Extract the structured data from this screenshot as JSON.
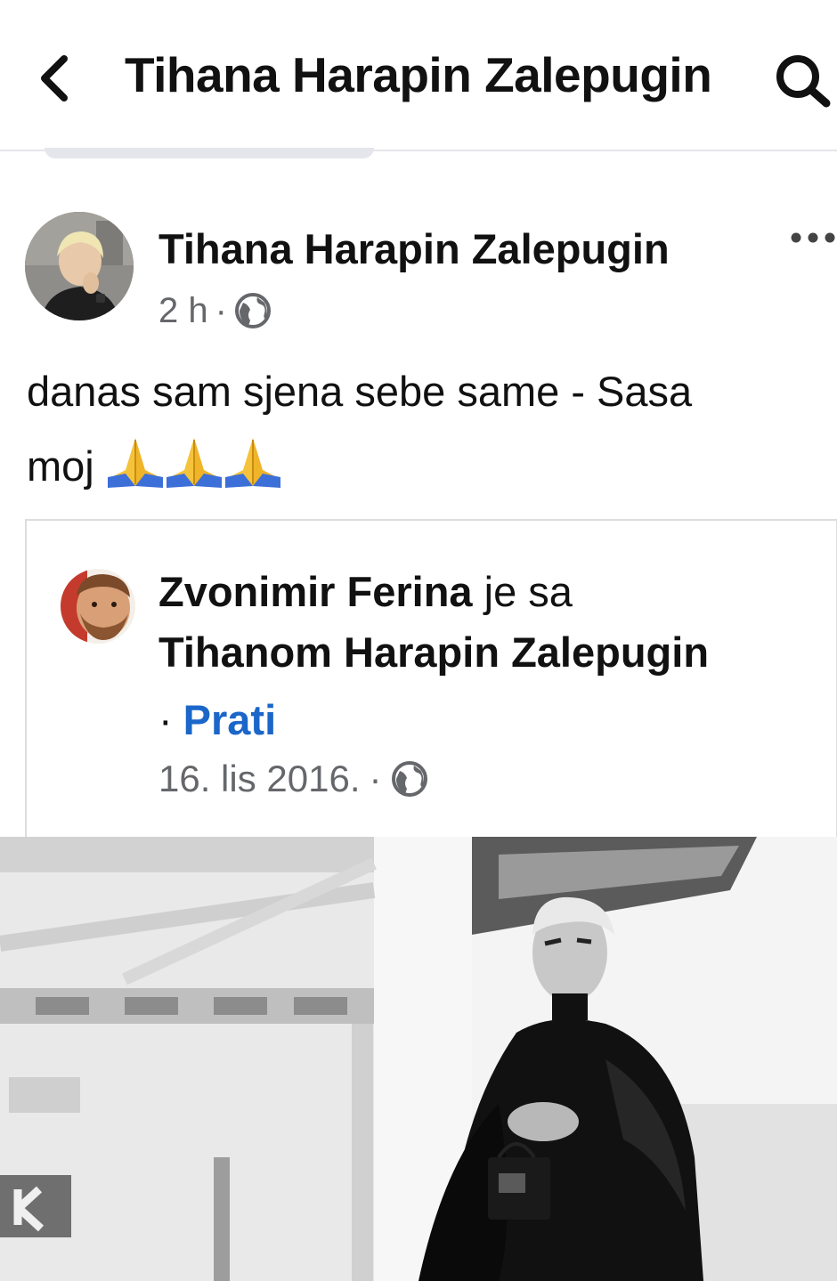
{
  "header": {
    "title": "Tihana Harapin Zalepugin",
    "back_icon": "chevron-left-icon",
    "search_icon": "search-icon"
  },
  "post": {
    "author": "Tihana Harapin Zalepugin",
    "time": "2 h",
    "separator": "·",
    "privacy_icon": "globe-icon",
    "more_icon": "more-horizontal-icon",
    "text_line1": "danas sam sjena sebe same - Sasa",
    "text_line2": "moj",
    "emoji_icon": "folded-hands-icon",
    "emoji_count": 3
  },
  "shared": {
    "author": "Zvonimir Ferina",
    "with_text": "je sa",
    "tagged": "Tihanom Harapin Zalepugin",
    "bullet": "·",
    "follow_label": "Prati",
    "date": "16. lis 2016.",
    "separator": "·",
    "privacy_icon": "globe-icon"
  },
  "colors": {
    "link": "#1b66c9",
    "meta": "#65676b",
    "divider": "#e4e6eb"
  }
}
